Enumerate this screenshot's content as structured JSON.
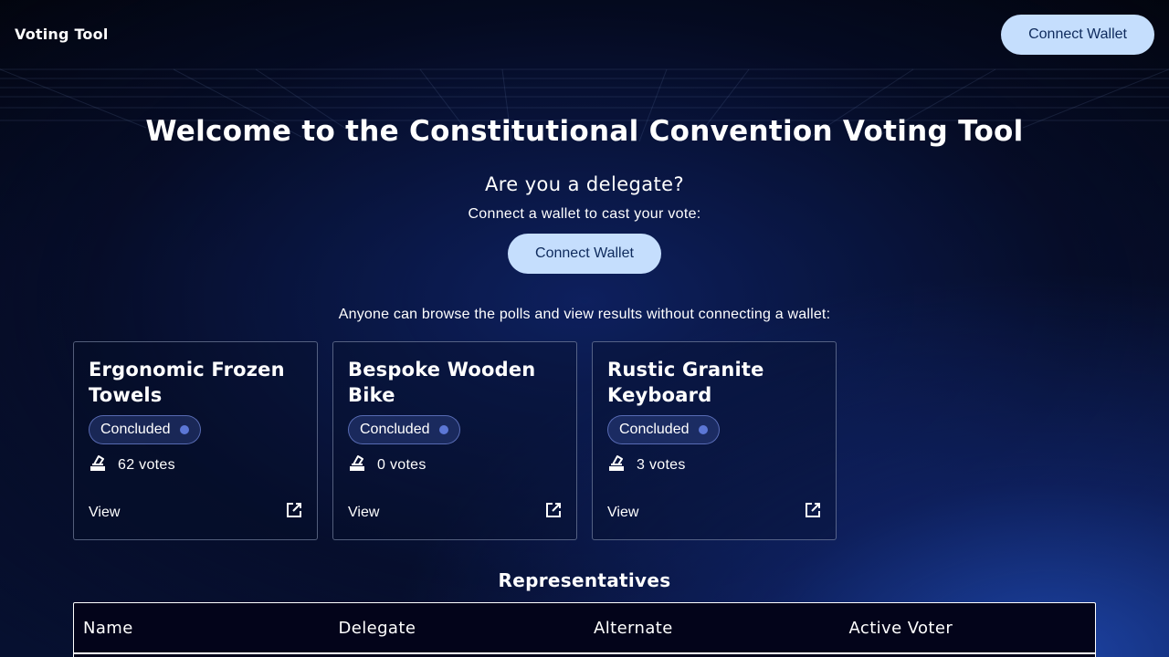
{
  "app": {
    "title": "Voting Tool"
  },
  "header": {
    "connect_label": "Connect Wallet"
  },
  "hero": {
    "title": "Welcome to the Constitutional Convention Voting Tool",
    "question": "Are you a delegate?",
    "hint": "Connect a wallet to cast your vote:",
    "connect_label": "Connect Wallet"
  },
  "browse_text": "Anyone can browse the polls and view results without connecting a wallet:",
  "polls": [
    {
      "title": "Ergonomic Frozen Towels",
      "status": "Concluded",
      "votes": "62 votes",
      "view_label": "View"
    },
    {
      "title": "Bespoke Wooden Bike",
      "status": "Concluded",
      "votes": "0 votes",
      "view_label": "View"
    },
    {
      "title": "Rustic Granite Keyboard",
      "status": "Concluded",
      "votes": "3 votes",
      "view_label": "View"
    }
  ],
  "representatives": {
    "title": "Representatives",
    "columns": [
      "Name",
      "Delegate",
      "Alternate",
      "Active Voter"
    ]
  },
  "icons": {
    "votes": "ballot-box-icon",
    "view": "external-link-icon",
    "status": "status-dot-icon"
  },
  "colors": {
    "button_bg": "#c5defd",
    "button_text": "#0e2a5c",
    "status_dot": "#5c77d6"
  }
}
